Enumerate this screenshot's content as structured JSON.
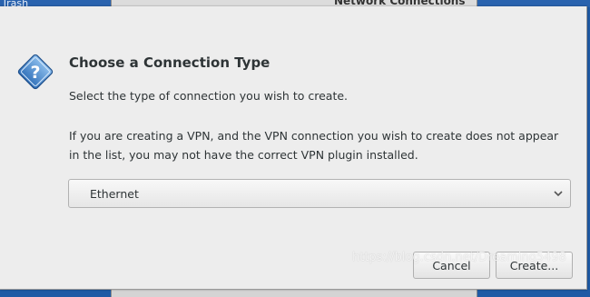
{
  "desktop": {
    "trash_label": "Trash"
  },
  "background_window": {
    "title": "Network Connections"
  },
  "dialog": {
    "icon": "question-icon",
    "title": "Choose a Connection Type",
    "subtitle": "Select the type of connection you wish to create.",
    "details": "If you are creating a VPN, and the VPN connection you wish to create does not appear in the list, you may not have the correct VPN plugin installed.",
    "connection_type": {
      "selected": "Ethernet",
      "arrow_icon": "chevron-down-icon"
    },
    "buttons": {
      "cancel": "Cancel",
      "create": "Create..."
    }
  },
  "watermark": "https://blog.csdn.net/Dreaming5498",
  "colors": {
    "desktop_bg": "#1f5aa5",
    "dialog_bg": "#ededed",
    "icon_blue": "#3a7fc8",
    "text": "#2e3436"
  }
}
